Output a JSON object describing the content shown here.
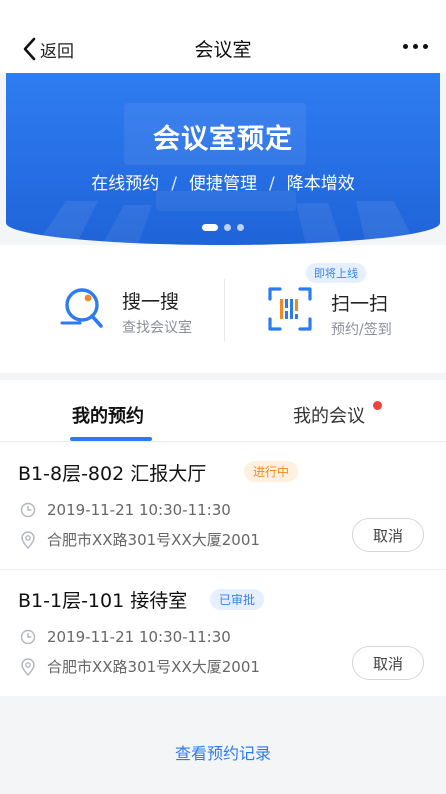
{
  "nav": {
    "back_label": "返回",
    "title": "会议室"
  },
  "banner": {
    "title": "会议室预定",
    "subtitle": [
      "在线预约",
      "便捷管理",
      "降本增效"
    ],
    "separator": "/",
    "slide_count": 3,
    "active_slide": 1
  },
  "quick_actions": [
    {
      "title": "搜一搜",
      "subtitle": "查找会议室",
      "icon": "search-icon"
    },
    {
      "title": "扫一扫",
      "subtitle": "预约/签到",
      "icon": "scan-icon",
      "tag": "即将上线"
    }
  ],
  "tabs": [
    {
      "label": "我的预约",
      "active": true
    },
    {
      "label": "我的会议",
      "has_notification_dot": true
    }
  ],
  "reservations": [
    {
      "room": "B1-8层-802 汇报大厅",
      "status": "进行中",
      "status_color": "#f08a24",
      "time": "2019-11-21 10:30-11:30",
      "address": "合肥市XX路301号XX大厦2001",
      "action": "取消"
    },
    {
      "room": "B1-1层-101 接待室",
      "status": "已审批",
      "status_color": "#3a82f0",
      "time": "2019-11-21 10:30-11:30",
      "address": "合肥市XX路301号XX大厦2001",
      "action": "取消"
    }
  ],
  "footer": {
    "view_records": "查看预约记录"
  },
  "colors": {
    "primary": "#2d7bf2",
    "accent_orange": "#f08a24",
    "notify_red": "#f0433a"
  }
}
